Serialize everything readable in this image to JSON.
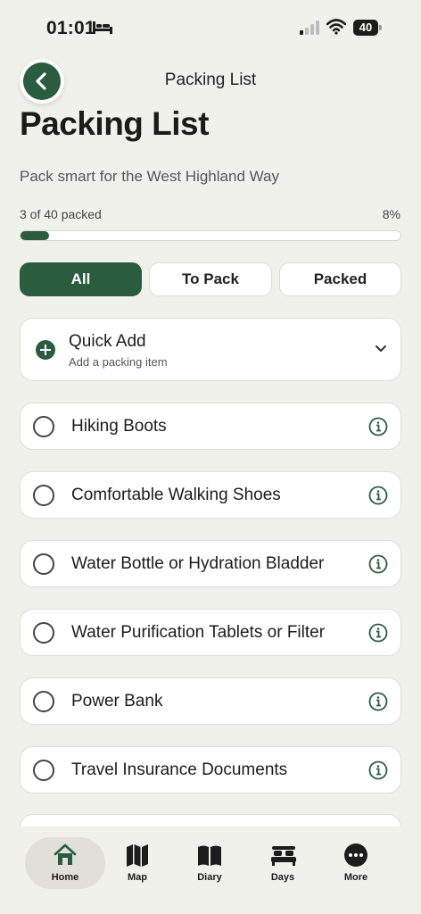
{
  "status_bar": {
    "time": "01:01",
    "battery": "40"
  },
  "nav": {
    "title": "Packing List",
    "back_icon": "chevron-left-icon"
  },
  "page": {
    "title": "Packing List",
    "subtitle": "Pack smart for the West Highland Way"
  },
  "progress": {
    "label": "3 of 40 packed",
    "percent_text": "8%",
    "fraction": 0.075
  },
  "filters": [
    {
      "label": "All",
      "active": true
    },
    {
      "label": "To Pack",
      "active": false
    },
    {
      "label": "Packed",
      "active": false
    }
  ],
  "quick_add": {
    "title": "Quick Add",
    "subtitle": "Add a packing item"
  },
  "items": [
    {
      "label": "Hiking Boots",
      "packed": false
    },
    {
      "label": "Comfortable Walking Shoes",
      "packed": false
    },
    {
      "label": "Water Bottle or Hydration Bladder",
      "packed": false
    },
    {
      "label": "Water Purification Tablets or Filter",
      "packed": false
    },
    {
      "label": "Power Bank",
      "packed": false
    },
    {
      "label": "Travel Insurance Documents",
      "packed": false
    }
  ],
  "tabs": [
    {
      "label": "Home",
      "icon": "home-icon",
      "active": true
    },
    {
      "label": "Map",
      "icon": "map-icon",
      "active": false
    },
    {
      "label": "Diary",
      "icon": "book-icon",
      "active": false
    },
    {
      "label": "Days",
      "icon": "bed-icon",
      "active": false
    },
    {
      "label": "More",
      "icon": "more-icon",
      "active": false
    }
  ],
  "colors": {
    "accent": "#2a5c3e",
    "background": "#f1f1ec",
    "card": "#ffffff"
  }
}
